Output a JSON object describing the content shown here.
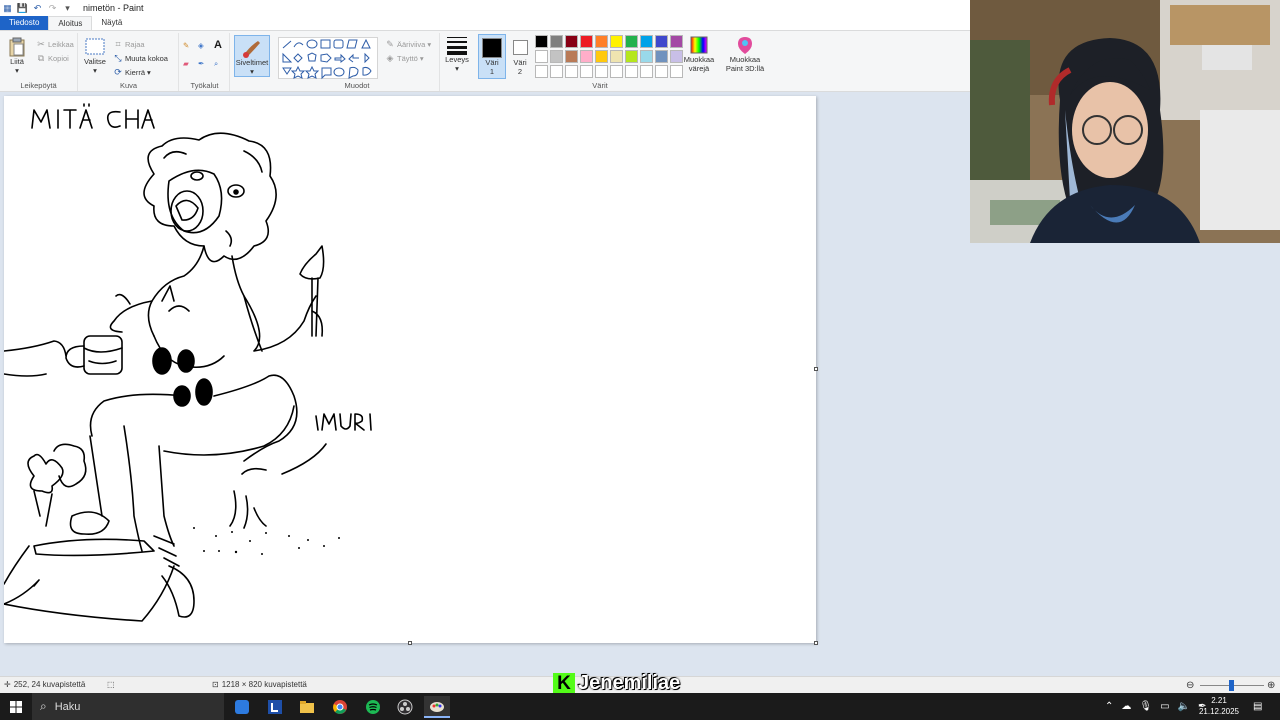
{
  "window": {
    "title": "nimetön - Paint"
  },
  "tabs": [
    "Tiedosto",
    "Aloitus",
    "Näytä"
  ],
  "ribbon": {
    "clipboard": {
      "paste": "Liitä",
      "cut": "Leikkaa",
      "copy": "Kopioi",
      "label": "Leikepöytä"
    },
    "image": {
      "select": "Valitse",
      "crop": "Rajaa",
      "resize": "Muuta kokoa",
      "rotate": "Kierrä",
      "label": "Kuva"
    },
    "tools": {
      "label": "Työkalut"
    },
    "brushes": {
      "label": "Siveltimet"
    },
    "shapes": {
      "outline": "Ääriviiva",
      "fill": "Täyttö",
      "label": "Muodot"
    },
    "size": {
      "label": "Leveys"
    },
    "color1": {
      "label": "Väri",
      "num": "1",
      "value": "#000000"
    },
    "color2": {
      "label": "Väri",
      "num": "2",
      "value": "#ffffff"
    },
    "edit_colors": {
      "line1": "Muokkaa",
      "line2": "värejä"
    },
    "paint3d": {
      "line1": "Muokkaa",
      "line2": "Paint 3D:llä"
    },
    "colors_label": "Värit",
    "palette": [
      "#000000",
      "#7f7f7f",
      "#880015",
      "#ed1c24",
      "#ff7f27",
      "#fff200",
      "#22b14c",
      "#00a2e8",
      "#3f48cc",
      "#a349a4",
      "#ffffff",
      "#c3c3c3",
      "#b97a57",
      "#ffaec9",
      "#ffc90e",
      "#efe4b0",
      "#b5e61d",
      "#99d9ea",
      "#7092be",
      "#c8bfe7",
      "#ffffff",
      "#ffffff",
      "#ffffff",
      "#ffffff",
      "#ffffff",
      "#ffffff",
      "#ffffff",
      "#ffffff",
      "#ffffff",
      "#ffffff"
    ]
  },
  "drawing": {
    "text_top": "MITÄ CHA",
    "text_imuri": "IMURI"
  },
  "statusbar": {
    "cursor_pos": "252, 24 kuvapistettä",
    "canvas_size": "1218 × 820 kuvapistettä"
  },
  "watermark": {
    "letter": "K",
    "name": "Jenemiliae"
  },
  "taskbar": {
    "search_placeholder": "Haku",
    "clock_time": "2.21",
    "clock_date": "21.12.2025"
  }
}
